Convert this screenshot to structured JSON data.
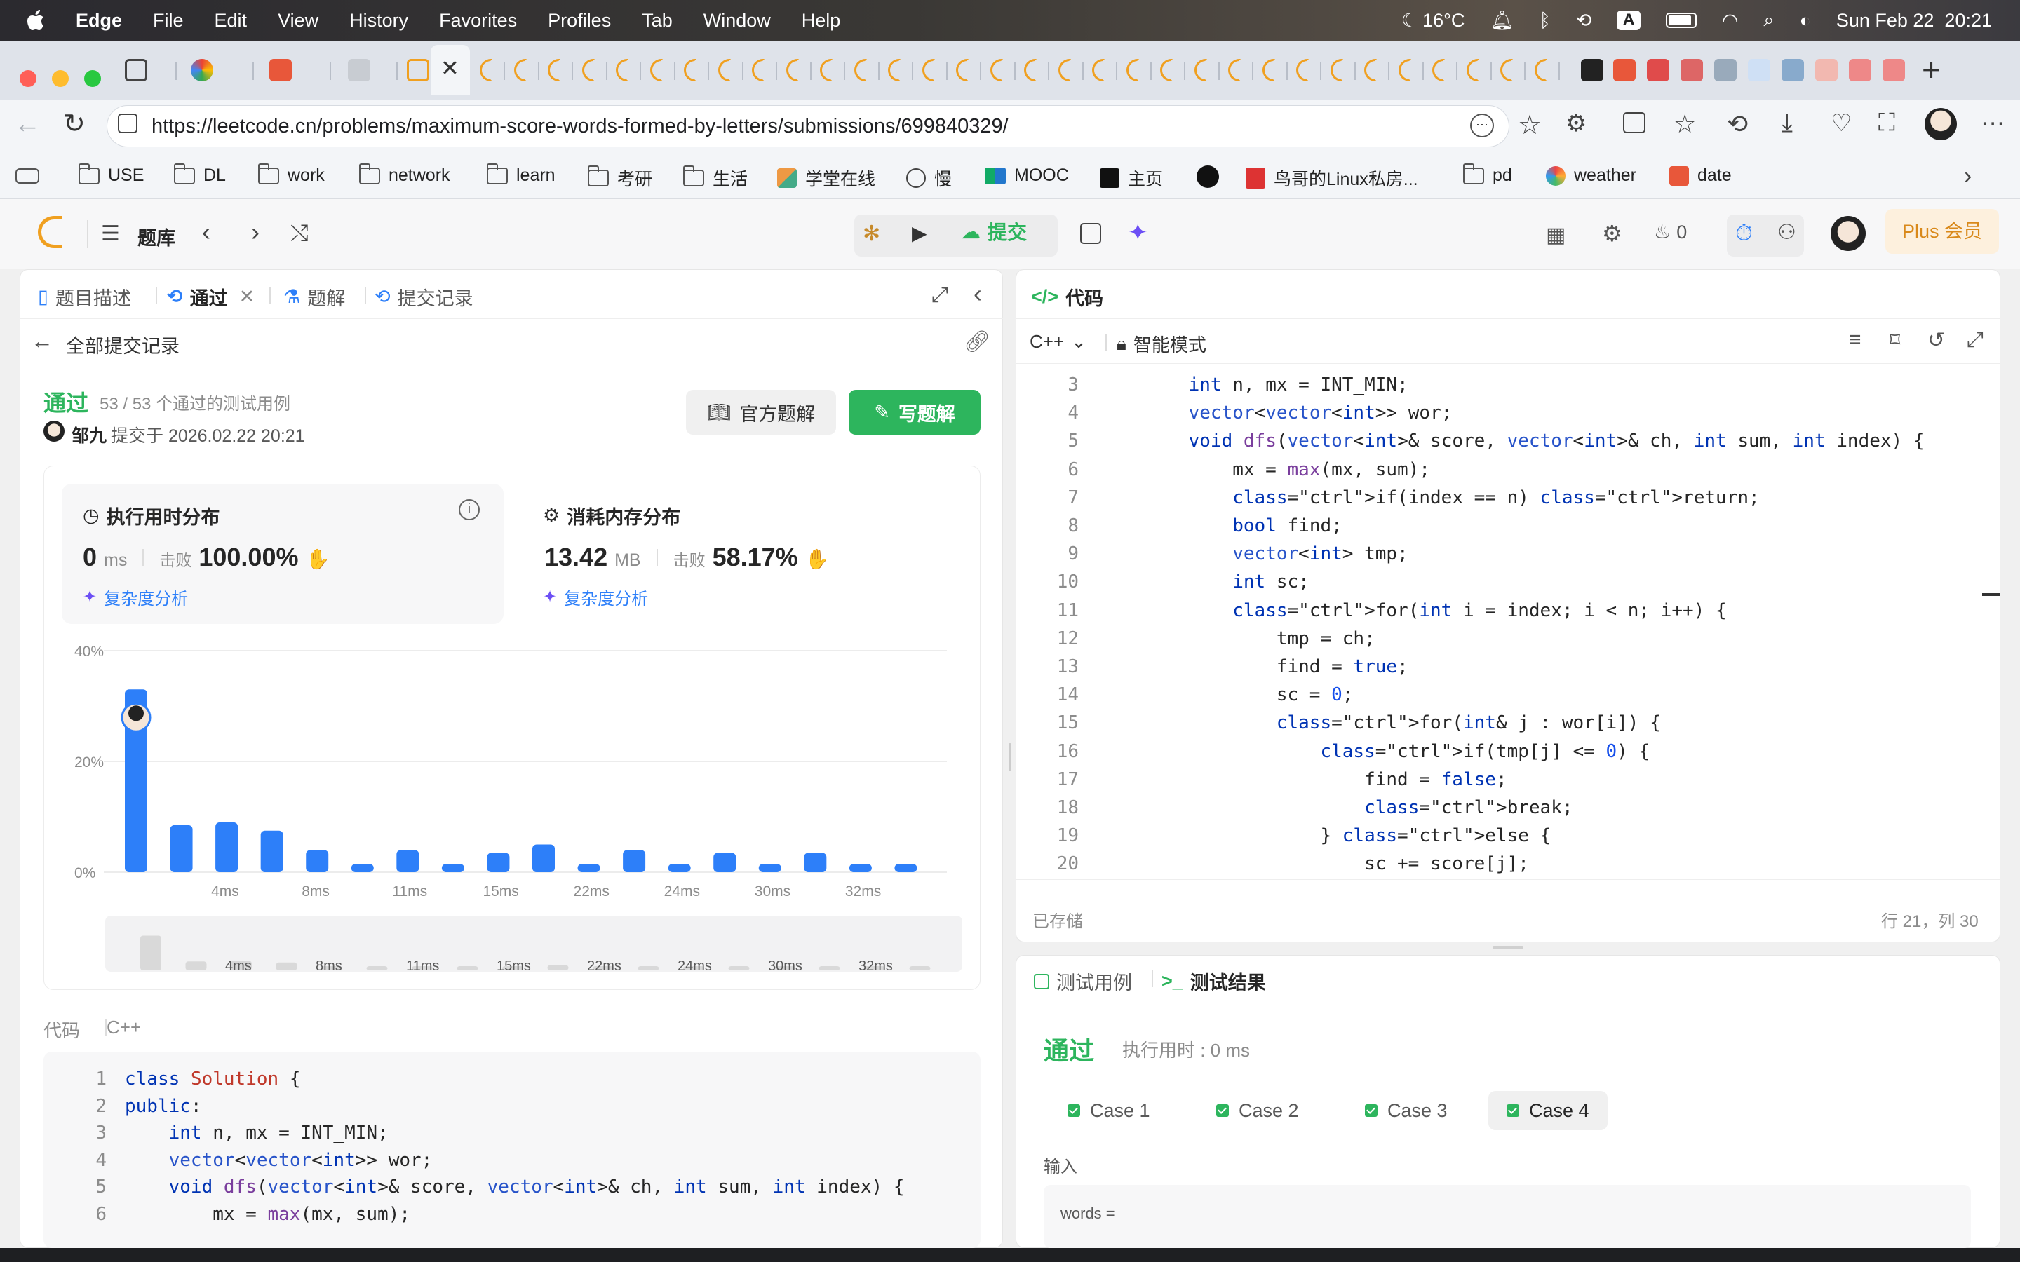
{
  "menubar": {
    "app": "Edge",
    "items": [
      "File",
      "Edit",
      "View",
      "History",
      "Favorites",
      "Profiles",
      "Tab",
      "Window",
      "Help"
    ],
    "weather": "16°C",
    "input_method": "A",
    "datetime": "Sun Feb 22  20:21"
  },
  "browser": {
    "url": "https://leetcode.cn/problems/maximum-score-words-formed-by-letters/submissions/699840329/",
    "bookmarks": [
      "USE",
      "DL",
      "work",
      "network",
      "learn",
      "考研",
      "生活",
      "学堂在线",
      "慢",
      "MOOC",
      "主页",
      "",
      "鸟哥的Linux私房...",
      "pd",
      "weather",
      "date"
    ]
  },
  "nav": {
    "problem_bank": "题库",
    "submit": "提交",
    "streak": "0",
    "plus": "Plus 会员"
  },
  "left": {
    "tabs": [
      "题目描述",
      "通过",
      "题解",
      "提交记录"
    ],
    "back_label": "全部提交记录",
    "status": "通过",
    "cases_passed": "53 / 53 个通过的测试用例",
    "author": "邹九",
    "submitted_at": "提交于 2026.02.22 20:21",
    "official_solution": "官方题解",
    "write_solution": "写题解",
    "runtime": {
      "title": "执行用时分布",
      "value": "0",
      "unit": "ms",
      "beat_label": "击败",
      "beat": "100.00%",
      "analysis": "复杂度分析"
    },
    "memory": {
      "title": "消耗内存分布",
      "value": "13.42",
      "unit": "MB",
      "beat_label": "击败",
      "beat": "58.17%",
      "analysis": "复杂度分析"
    },
    "code_label": "代码",
    "code_lang": "C++"
  },
  "chart_data": {
    "type": "bar",
    "ylim": [
      0,
      40
    ],
    "y_ticks": [
      "40%",
      "20%",
      "0%"
    ],
    "x_ticks": [
      "4ms",
      "8ms",
      "11ms",
      "15ms",
      "22ms",
      "24ms",
      "30ms",
      "32ms"
    ],
    "values": [
      33,
      8.5,
      9,
      7.5,
      4,
      1.5,
      4,
      1.5,
      3.5,
      5,
      1.5,
      4,
      1.5,
      3.5,
      1.5,
      3.5,
      1.5,
      1.5
    ],
    "highlight_index": 0
  },
  "right": {
    "code_title": "代码",
    "lang": "C++",
    "mode": "智能模式",
    "saved": "已存储",
    "cursor": "行 21，列 30",
    "tabs": [
      "测试用例",
      "测试结果"
    ],
    "result_status": "通过",
    "runtime_text": "执行用时 : 0 ms",
    "cases": [
      "Case 1",
      "Case 2",
      "Case 3",
      "Case 4"
    ],
    "input_label": "输入",
    "input_var": "words ="
  },
  "code_top": [
    "class Solution {",
    "public:",
    "    int n, mx = INT_MIN;",
    "    vector<vector<int>> wor;",
    "    void dfs(vector<int>& score, vector<int>& ch, int sum, int index) {",
    "        mx = max(mx, sum);"
  ],
  "code_editor": [
    "    int n, mx = INT_MIN;",
    "    vector<vector<int>> wor;",
    "    void dfs(vector<int>& score, vector<int>& ch, int sum, int index) {",
    "        mx = max(mx, sum);",
    "        if(index == n) return;",
    "        bool find;",
    "        vector<int> tmp;",
    "        int sc;",
    "        for(int i = index; i < n; i++) {",
    "            tmp = ch;",
    "            find = true;",
    "            sc = 0;",
    "            for(int& j : wor[i]) {",
    "                if(tmp[j] <= 0) {",
    "                    find = false;",
    "                    break;",
    "                } else {",
    "                    sc += score[j];"
  ]
}
